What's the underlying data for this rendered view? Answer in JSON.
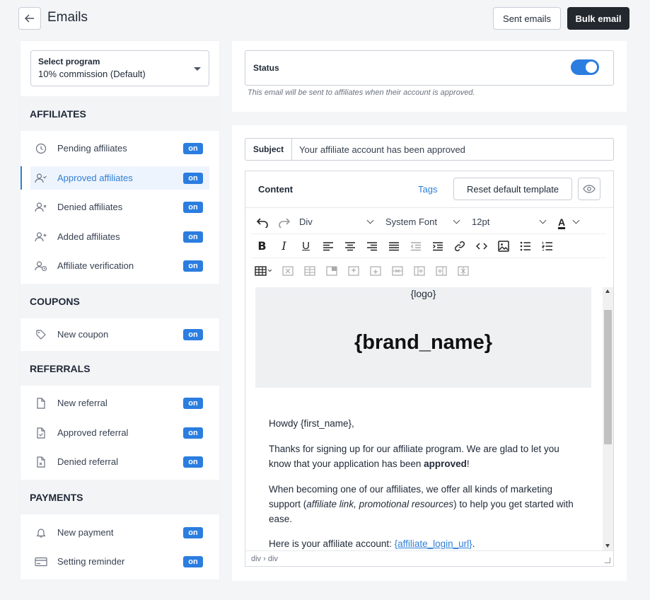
{
  "header": {
    "title": "Emails",
    "sent_label": "Sent emails",
    "bulk_label": "Bulk email"
  },
  "program": {
    "label": "Select program",
    "value": "10% commission (Default)"
  },
  "sections": {
    "affiliates": {
      "title": "AFFILIATES",
      "items": [
        {
          "label": "Pending affiliates",
          "badge": "on",
          "icon": "clock-icon"
        },
        {
          "label": "Approved affiliates",
          "badge": "on",
          "icon": "user-check-icon"
        },
        {
          "label": "Denied affiliates",
          "badge": "on",
          "icon": "user-x-icon"
        },
        {
          "label": "Added affiliates",
          "badge": "on",
          "icon": "user-plus-icon"
        },
        {
          "label": "Affiliate verification",
          "badge": "on",
          "icon": "user-clock-icon"
        }
      ]
    },
    "coupons": {
      "title": "COUPONS",
      "items": [
        {
          "label": "New coupon",
          "badge": "on",
          "icon": "tag-icon"
        }
      ]
    },
    "referrals": {
      "title": "REFERRALS",
      "items": [
        {
          "label": "New referral",
          "badge": "on",
          "icon": "file-icon"
        },
        {
          "label": "Approved referral",
          "badge": "on",
          "icon": "file-check-icon"
        },
        {
          "label": "Denied referral",
          "badge": "on",
          "icon": "file-x-icon"
        }
      ]
    },
    "payments": {
      "title": "PAYMENTS",
      "items": [
        {
          "label": "New payment",
          "badge": "on",
          "icon": "bell-icon"
        },
        {
          "label": "Setting reminder",
          "badge": "on",
          "icon": "credit-card-icon"
        }
      ]
    }
  },
  "status": {
    "label": "Status",
    "enabled": true,
    "help": "This email will be sent to affiliates when their account is approved."
  },
  "subject": {
    "label": "Subject",
    "value": "Your affiliate account has been approved"
  },
  "editor": {
    "title": "Content",
    "tags_label": "Tags",
    "reset_label": "Reset default template",
    "block_select": "Div",
    "font_select": "System Font",
    "size_select": "12pt",
    "text_color_letter": "A",
    "path": "div › div"
  },
  "template": {
    "logo": "{logo}",
    "brand": "{brand_name}",
    "greeting": "Howdy {first_name},",
    "p1_a": "Thanks for signing up for our affiliate program. We are glad to let you know that your application has been ",
    "p1_bold": "approved",
    "p1_b": "!",
    "p2_a": "When becoming one of our affiliates, we offer all kinds of marketing support (",
    "p2_italic": "affiliate link, promotional resources",
    "p2_b": ") to help you get started with ease.",
    "p3_a": "Here is your affiliate account: ",
    "p3_link": "{affiliate_login_url}",
    "p3_b": "."
  },
  "colors": {
    "accent": "#2b7de0",
    "dark_button": "#23272e"
  }
}
